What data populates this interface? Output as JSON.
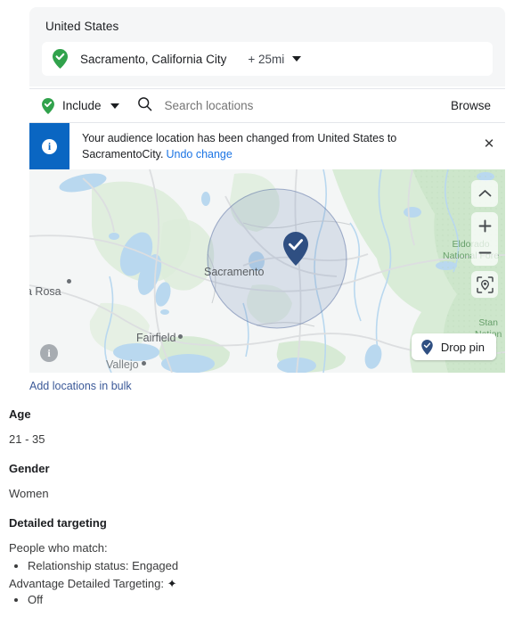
{
  "location_card": {
    "title": "United States",
    "selected_chip": {
      "pin_icon": "green-check-pin-icon",
      "label": "Sacramento, California City",
      "radius": "+ 25mi",
      "caret_icon": "chevron-down-icon"
    },
    "search_row": {
      "include_icon": "green-check-pin-icon",
      "include_label": "Include",
      "include_caret_icon": "chevron-down-icon",
      "search_icon": "search-icon",
      "search_value": "",
      "search_placeholder": "Search locations",
      "browse_label": "Browse"
    },
    "banner": {
      "icon": "info-icon",
      "text": "Your audience location has been changed from United States to SacramentoCity.",
      "undo_label": "Undo change",
      "close_icon": "close-icon",
      "accent_color": "#0a66c2"
    },
    "map": {
      "city_labels": [
        "a Rosa",
        "Sacramento",
        "Fairfield",
        "Vallejo"
      ],
      "forest_labels": [
        "Eldorado\nNational Fore",
        "Stan\nNation"
      ],
      "pin_icon": "map-pin-check-icon",
      "pin_color": "#2f4f82",
      "radius_circle_color": "#6b80b0",
      "controls": {
        "collapse_icon": "chevron-up-icon",
        "zoom_in_icon": "plus-icon",
        "zoom_out_icon": "minus-icon",
        "locate_icon": "locate-target-icon"
      },
      "drop_pin": {
        "icon": "pin-icon",
        "label": "Drop pin"
      },
      "info_badge_icon": "info-icon"
    },
    "bulk_link": "Add locations in bulk"
  },
  "sections": {
    "age": {
      "title": "Age",
      "value": "21 - 35"
    },
    "gender": {
      "title": "Gender",
      "value": "Women"
    },
    "detailed_targeting": {
      "title": "Detailed targeting",
      "match_label": "People who match:",
      "match_items": [
        "Relationship status: Engaged"
      ],
      "advantage_label": "Advantage Detailed Targeting:",
      "advantage_icon": "sparkle-icon",
      "advantage_items": [
        "Off"
      ]
    }
  },
  "colors": {
    "green_pin": "#31a24c",
    "link_blue": "#3b5998",
    "banner_blue": "#0a66c2",
    "card_bg": "#f5f6f7"
  }
}
